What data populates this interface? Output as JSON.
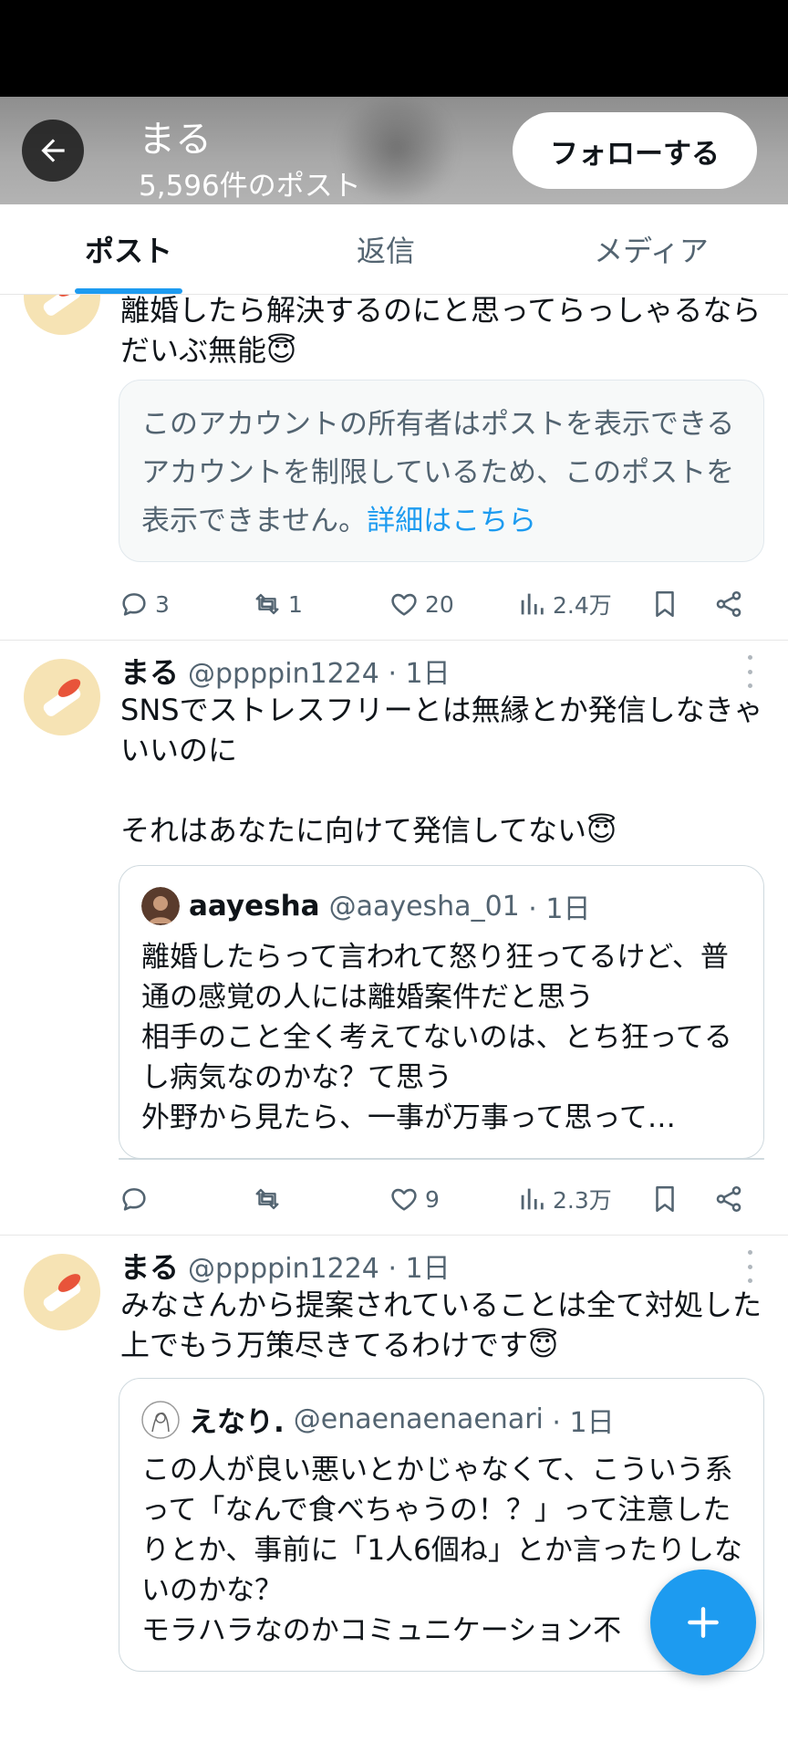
{
  "header": {
    "name": "まる",
    "post_count": "5,596件のポスト",
    "follow_label": "フォローする"
  },
  "tabs": [
    {
      "label": "ポスト",
      "active": true
    },
    {
      "label": "返信",
      "active": false
    },
    {
      "label": "メディア",
      "active": false
    }
  ],
  "posts": [
    {
      "text": "離婚したら解決するのにと思ってらっしゃるならだいぶ無能😇",
      "notice": {
        "text": "このアカウントの所有者はポストを表示できるアカウントを制限しているため、このポストを表示できません。",
        "link": "詳細はこちら"
      },
      "actions": {
        "replies": "3",
        "reposts": "1",
        "likes": "20",
        "views": "2.4万"
      }
    },
    {
      "name": "まる",
      "handle": "@ppppin1224",
      "time": "· 1日",
      "text": "SNSでストレスフリーとは無縁とか発信しなきゃいいのに\n\nそれはあなたに向けて発信してない😇",
      "quote": {
        "name": "aayesha",
        "handle": "@aayesha_01",
        "time": "· 1日",
        "text": "離婚したらって言われて怒り狂ってるけど、普通の感覚の人には離婚案件だと思う\n相手のこと全く考えてないのは、とち狂ってるし病気なのかな？て思う\n外野から見たら、一事が万事って思って…"
      },
      "actions": {
        "replies": "",
        "reposts": "",
        "likes": "9",
        "views": "2.3万"
      }
    },
    {
      "name": "まる",
      "handle": "@ppppin1224",
      "time": "· 1日",
      "text": "みなさんから提案されていることは全て対処した上でもう万策尽きてるわけです😇",
      "quote": {
        "name": "えなり.",
        "handle": "@enaenaenaenari",
        "time": "· 1日",
        "text": "この人が良い悪いとかじゃなくて、こういう系って「なんで食べちゃうの！？」って注意したりとか、事前に「1人6個ね」とか言ったりしないのかな？\nモラハラなのかコミュニケーション不"
      }
    }
  ]
}
